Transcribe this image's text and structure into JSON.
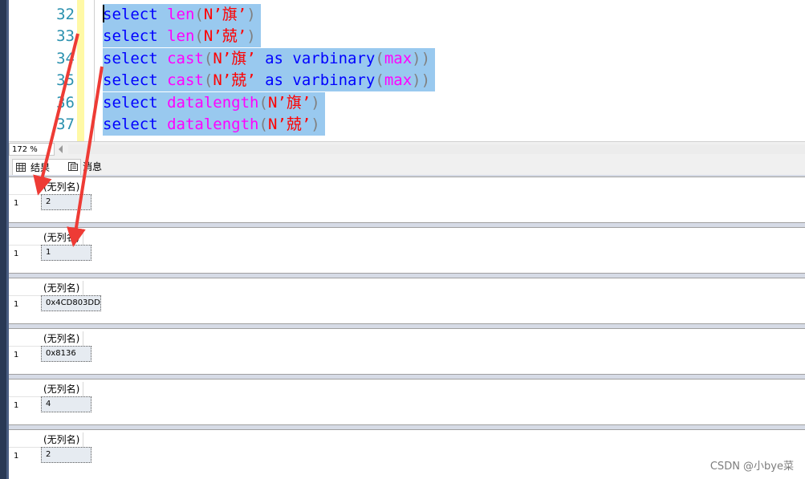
{
  "editor": {
    "lines": [
      {
        "num": "32",
        "kw": "select",
        "fn": "len",
        "open": "(",
        "str": "N’旗’",
        "close": ")",
        "tail": ""
      },
      {
        "num": "33",
        "kw": "select",
        "fn": "len",
        "open": "(",
        "str": "N’兢’",
        "close": ")",
        "tail": ""
      },
      {
        "num": "34",
        "kw": "select",
        "fn": "cast",
        "open": "(",
        "str": "N’旗’",
        "as": " as ",
        "type": "varbinary",
        "open2": "(",
        "fn2": "max",
        "close2": "))"
      },
      {
        "num": "35",
        "kw": "select",
        "fn": "cast",
        "open": "(",
        "str": "N’兢’",
        "as": " as ",
        "type": "varbinary",
        "open2": "(",
        "fn2": "max",
        "close2": "))"
      },
      {
        "num": "36",
        "kw": "select",
        "fn": "datalength",
        "open": "(",
        "str": "N’旗’",
        "close": ")",
        "tail": ""
      },
      {
        "num": "37",
        "kw": "select",
        "fn": "datalength",
        "open": "(",
        "str": "N’兢’",
        "close": ")",
        "tail": ""
      }
    ]
  },
  "status": {
    "zoom": "172 %"
  },
  "tabs": {
    "results": "结果",
    "messages": "消息"
  },
  "results": [
    {
      "header": "(无列名)",
      "row": "1",
      "value": "2"
    },
    {
      "header": "(无列名)",
      "row": "1",
      "value": "1"
    },
    {
      "header": "(无列名)",
      "row": "1",
      "value": "0x4CD803DD"
    },
    {
      "header": "(无列名)",
      "row": "1",
      "value": "0x8136"
    },
    {
      "header": "(无列名)",
      "row": "1",
      "value": "4"
    },
    {
      "header": "(无列名)",
      "row": "1",
      "value": "2"
    }
  ],
  "watermark": "CSDN @小bye菜",
  "colors": {
    "selection": "#99c9ef",
    "keyword": "#0000ff",
    "function": "#ff00ff",
    "string": "#ff0000",
    "line_number": "#2b91af",
    "arrow": "#ee3b35"
  }
}
